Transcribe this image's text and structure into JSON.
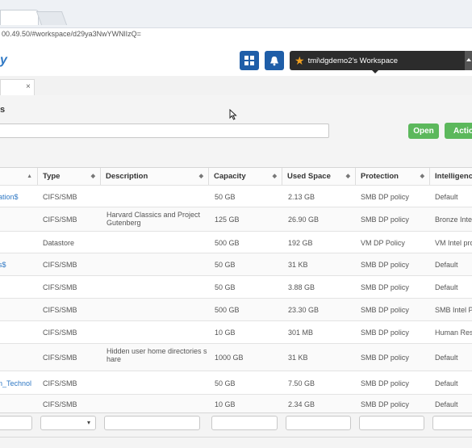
{
  "browser": {
    "address": "00.49.50/#workspace/d29ya3NwYWNlIzQ="
  },
  "header": {
    "logo": "y",
    "workspace_label": "tmi\\dgdemo2's Workspace",
    "icons": [
      "grid-icon",
      "bell-icon",
      "star-icon",
      "caret-up-icon"
    ]
  },
  "page_tab": {
    "close": "×"
  },
  "section": {
    "title": "s"
  },
  "buttons": {
    "open": "Open",
    "actions": "Actio"
  },
  "table": {
    "columns": [
      {
        "label": "",
        "sort": "▲"
      },
      {
        "label": "Type",
        "sort": "◆"
      },
      {
        "label": "Description",
        "sort": "◆"
      },
      {
        "label": "Capacity",
        "sort": "◆"
      },
      {
        "label": "Used Space",
        "sort": "◆"
      },
      {
        "label": "Protection",
        "sort": "◆"
      },
      {
        "label": "Intelligence",
        "sort": ""
      }
    ],
    "rows": [
      {
        "name": "ation$",
        "type": "CIFS/SMB",
        "desc": "",
        "capacity": "50 GB",
        "used": "2.13 GB",
        "protection": "SMB DP policy",
        "intel": "Default"
      },
      {
        "name": "",
        "type": "CIFS/SMB",
        "desc": "Harvard Classics and Project Gutenberg",
        "capacity": "125 GB",
        "used": "26.90 GB",
        "protection": "SMB DP policy",
        "intel": "Bronze Intel"
      },
      {
        "name": "",
        "type": "Datastore",
        "desc": "",
        "capacity": "500 GB",
        "used": "192 GB",
        "protection": "VM DP Policy",
        "intel": "VM Intel pro"
      },
      {
        "name": "s$",
        "type": "CIFS/SMB",
        "desc": "",
        "capacity": "50 GB",
        "used": "31 KB",
        "protection": "SMB DP policy",
        "intel": "Default"
      },
      {
        "name": "",
        "type": "CIFS/SMB",
        "desc": "",
        "capacity": "50 GB",
        "used": "3.88 GB",
        "protection": "SMB DP policy",
        "intel": "Default"
      },
      {
        "name": "l",
        "type": "CIFS/SMB",
        "desc": "",
        "capacity": "500 GB",
        "used": "23.30 GB",
        "protection": "SMB DP policy",
        "intel": "SMB Intel P"
      },
      {
        "name": "",
        "type": "CIFS/SMB",
        "desc": "",
        "capacity": "10 GB",
        "used": "301 MB",
        "protection": "SMB DP policy",
        "intel": "Human Reso"
      },
      {
        "name": "",
        "type": "CIFS/SMB",
        "desc": "Hidden user home directories s hare",
        "capacity": "1000 GB",
        "used": "31 KB",
        "protection": "SMB DP policy",
        "intel": "Default"
      },
      {
        "name": "n_Technol",
        "type": "CIFS/SMB",
        "desc": "",
        "capacity": "50 GB",
        "used": "7.50 GB",
        "protection": "SMB DP policy",
        "intel": "Default"
      },
      {
        "name": "",
        "type": "CIFS/SMB",
        "desc": "",
        "capacity": "10 GB",
        "used": "2.34 GB",
        "protection": "SMB DP policy",
        "intel": "Default"
      }
    ]
  },
  "filters": {
    "type_caret": "▾"
  },
  "colors": {
    "accent_blue": "#1f5ea8",
    "link": "#2f78c4",
    "green": "#5cb85c",
    "dark": "#2c2c2c"
  }
}
